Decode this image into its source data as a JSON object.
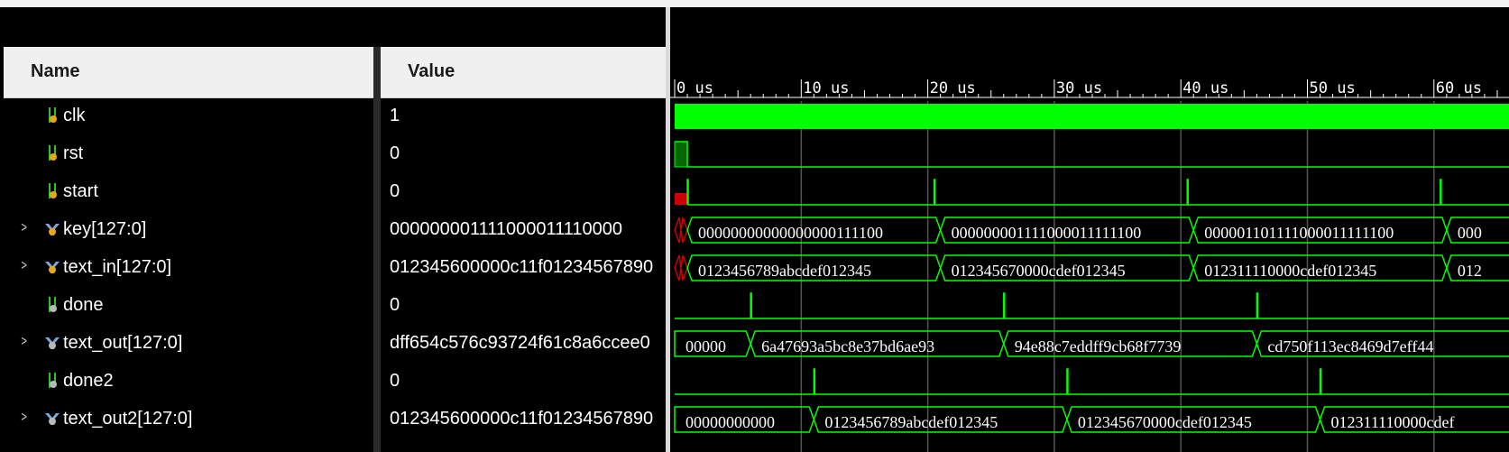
{
  "columns": {
    "name": "Name",
    "value": "Value"
  },
  "time_axis": {
    "unit": "us",
    "range_us": [
      0,
      66
    ],
    "tick_labels": [
      "0 us",
      "10 us",
      "20 us",
      "30 us",
      "40 us",
      "50 us",
      "60 us"
    ]
  },
  "colors": {
    "wave_green": "#00ff00",
    "reset_green": "#006600",
    "unknown_red": "#cc0000",
    "cursor_line": "#555555"
  },
  "signals": [
    {
      "name": "clk",
      "value": "1",
      "type": "bit",
      "icon": "input-bit-icon"
    },
    {
      "name": "rst",
      "value": "0",
      "type": "bit",
      "icon": "input-bit-icon"
    },
    {
      "name": "start",
      "value": "0",
      "type": "bit",
      "icon": "input-bit-icon"
    },
    {
      "name": "key[127:0]",
      "value": "000000001111000011110000",
      "type": "bus",
      "icon": "input-bus-icon",
      "segments": [
        "00000000000000000111100",
        "000000001111000011111100",
        "000001101111000011111100",
        "000"
      ]
    },
    {
      "name": "text_in[127:0]",
      "value": "012345600000c11f01234567890",
      "type": "bus",
      "icon": "input-bus-icon",
      "segments": [
        "0123456789abcdef012345",
        "012345670000cdef012345",
        "012311110000cdef012345",
        "012"
      ]
    },
    {
      "name": "done",
      "value": "0",
      "type": "bit",
      "icon": "output-bit-icon"
    },
    {
      "name": "text_out[127:0]",
      "value": "dff654c576c93724f61c8a6ccee0",
      "type": "bus",
      "icon": "output-bus-icon",
      "segments": [
        "00000",
        "6a47693a5bc8e37bd6ae93",
        "94e88c7eddff9cb68f7739",
        "cd750f113ec8469d7eff44"
      ]
    },
    {
      "name": "done2",
      "value": "0",
      "type": "bit",
      "icon": "output-bit-icon"
    },
    {
      "name": "text_out2[127:0]",
      "value": "012345600000c11f01234567890",
      "type": "bus",
      "icon": "output-bus-icon",
      "segments": [
        "00000000000",
        "0123456789abcdef012345",
        "012345670000cdef012345",
        "012311110000cdef"
      ]
    }
  ]
}
